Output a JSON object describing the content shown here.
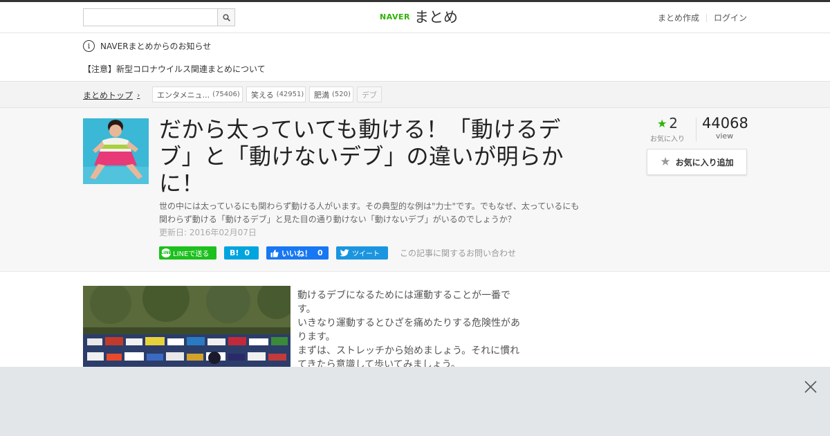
{
  "header": {
    "search_placeholder": "",
    "logo_brand": "NAVER",
    "logo_text": "まとめ",
    "links": [
      "まとめ作成",
      "ログイン"
    ]
  },
  "notice": {
    "heading": "NAVERまとめからのお知らせ",
    "link": "【注意】新型コロナウイルス関連まとめについて"
  },
  "breadcrumb": {
    "top": "まとめトップ",
    "tags": [
      {
        "label": "エンタメニュ...",
        "count": "(75406)"
      },
      {
        "label": "笑える",
        "count": "(42951)"
      },
      {
        "label": "肥満",
        "count": "(520)"
      },
      {
        "label": "デブ",
        "count": ""
      }
    ]
  },
  "article": {
    "title": "だから太っていても動ける！「動けるデブ」と「動けないデブ」の違いが明らかに！",
    "description": "世の中には太っているにも関わらず動ける人がいます。その典型的な例は\"力士\"です。でもなぜ、太っているにも関わらず動ける「動けるデブ」と見た目の通り動けない「動けないデブ」がいるのでしょうか？",
    "updated": "更新日: 2016年02月07日",
    "favorites": "2",
    "favorites_label": "お気に入り",
    "views": "44068",
    "views_label": "view",
    "fav_button": "お気に入り追加"
  },
  "social": {
    "line": "LINEで送る",
    "hatena_icon": "B!",
    "hatena_count": "0",
    "fb_label": "いいね！",
    "fb_count": "0",
    "tweet": "ツイート",
    "contact": "この記事に関するお問い合わせ"
  },
  "content": {
    "text_lines": [
      "動けるデブになるためには運動することが一番で",
      "す。",
      "いきなり運動するとひざを痛めたりする危険性があ",
      "ります。",
      "まずは、ストレッチから始めましょう。それに慣れ",
      "てきたら意識して歩いてみましょう。"
    ]
  },
  "colors": {
    "naver_green": "#2db400",
    "line_green": "#1dc01d",
    "hatena_blue": "#00a4de",
    "facebook_blue": "#1877f2",
    "twitter_blue": "#1b95e0"
  }
}
